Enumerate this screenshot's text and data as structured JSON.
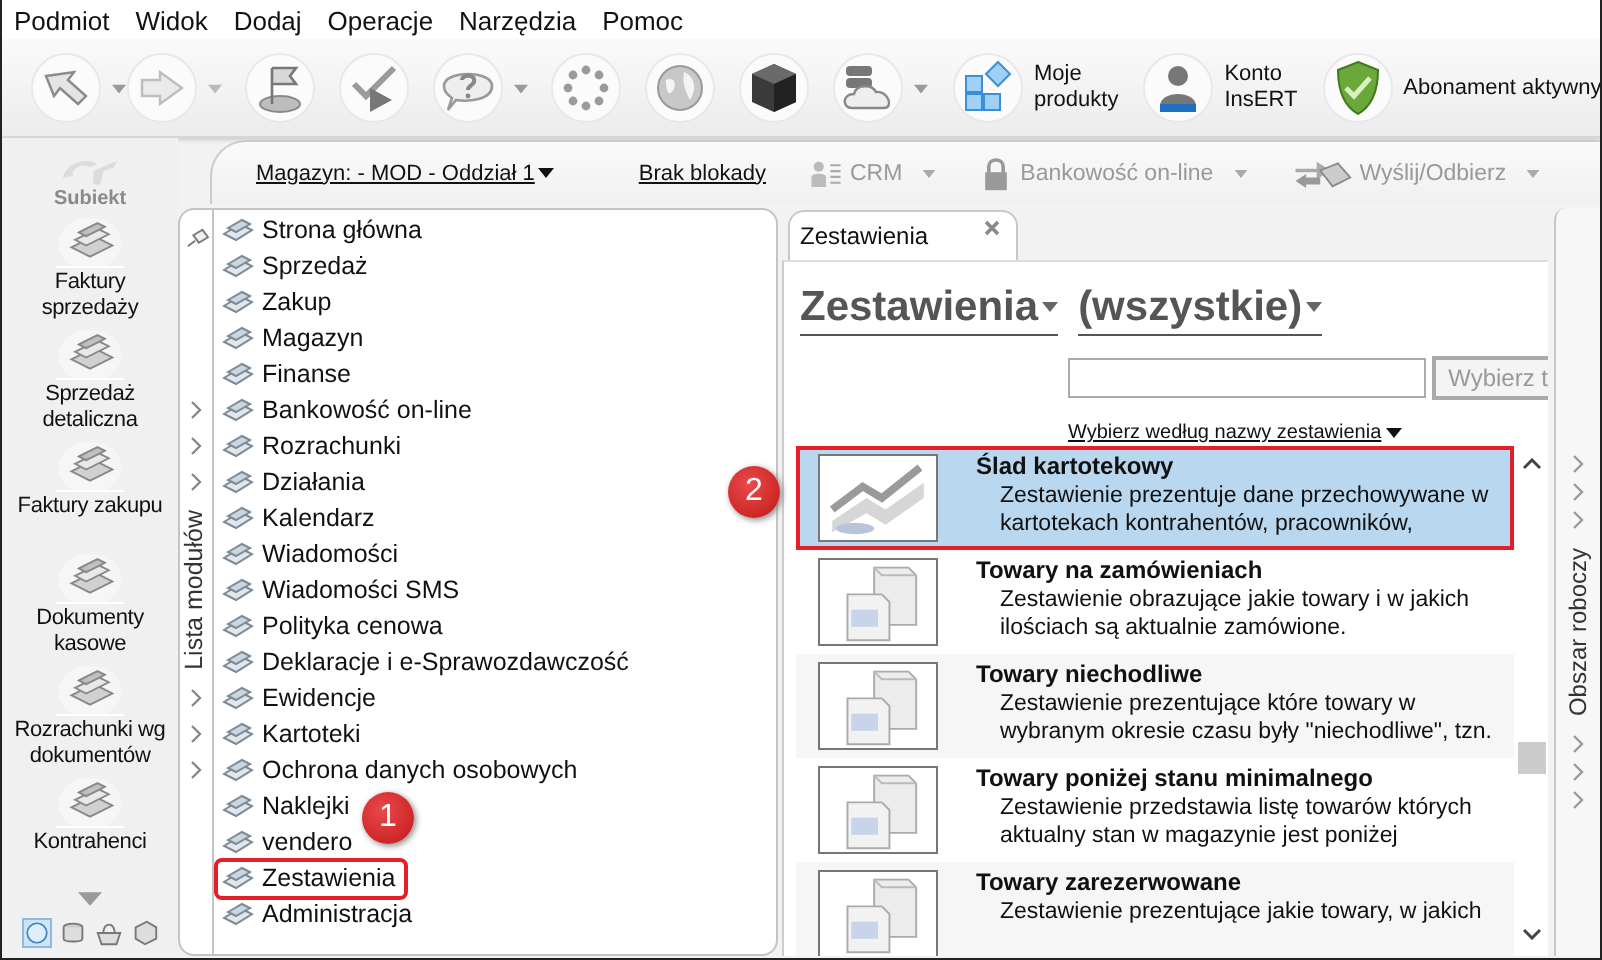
{
  "menu": [
    "Podmiot",
    "Widok",
    "Dodaj",
    "Operacje",
    "Narzędzia",
    "Pomoc"
  ],
  "toolbar": {
    "buttons": [
      {
        "kind": "products",
        "label": "Moje produkty"
      },
      {
        "kind": "account",
        "label": "Konto InsERT"
      },
      {
        "kind": "subscription",
        "label": "Abonament aktywny"
      }
    ]
  },
  "app_logo": {
    "label": "Subiekt"
  },
  "nav": {
    "items": [
      {
        "label": "Faktury sprzedaży"
      },
      {
        "label": "Sprzedaż detaliczna"
      },
      {
        "label": "Faktury zakupu"
      },
      {
        "label": "Dokumenty kasowe"
      },
      {
        "label": "Rozrachunki wg dokumentów"
      },
      {
        "label": "Kontrahenci"
      }
    ]
  },
  "topbar": {
    "warehouse": "Magazyn: - MOD - Oddział 1",
    "lock": "Brak blokady",
    "actions": [
      {
        "kind": "crm",
        "label": "CRM",
        "disabled": true
      },
      {
        "kind": "bank",
        "label": "Bankowość on-line",
        "disabled": true
      },
      {
        "kind": "send",
        "label": "Wyślij/Odbierz",
        "disabled": true
      }
    ]
  },
  "modules": {
    "title": "Lista modułów",
    "items": [
      {
        "label": "Strona główna",
        "expandable": false,
        "highlighted": false
      },
      {
        "label": "Sprzedaż",
        "expandable": false,
        "highlighted": false
      },
      {
        "label": "Zakup",
        "expandable": false,
        "highlighted": false
      },
      {
        "label": "Magazyn",
        "expandable": false,
        "highlighted": false
      },
      {
        "label": "Finanse",
        "expandable": false,
        "highlighted": false
      },
      {
        "label": "Bankowość on-line",
        "expandable": true,
        "highlighted": false
      },
      {
        "label": "Rozrachunki",
        "expandable": true,
        "highlighted": false
      },
      {
        "label": "Działania",
        "expandable": true,
        "highlighted": false
      },
      {
        "label": "Kalendarz",
        "expandable": false,
        "highlighted": false
      },
      {
        "label": "Wiadomości",
        "expandable": false,
        "highlighted": false
      },
      {
        "label": "Wiadomości SMS",
        "expandable": false,
        "highlighted": false
      },
      {
        "label": "Polityka cenowa",
        "expandable": false,
        "highlighted": false
      },
      {
        "label": "Deklaracje i e-Sprawozdawczość",
        "expandable": false,
        "highlighted": false
      },
      {
        "label": "Ewidencje",
        "expandable": true,
        "highlighted": false
      },
      {
        "label": "Kartoteki",
        "expandable": true,
        "highlighted": false
      },
      {
        "label": "Ochrona danych osobowych",
        "expandable": true,
        "highlighted": false
      },
      {
        "label": "Naklejki",
        "expandable": false,
        "highlighted": false
      },
      {
        "label": "vendero",
        "expandable": false,
        "highlighted": false
      },
      {
        "label": "Zestawienia",
        "expandable": false,
        "highlighted": true
      },
      {
        "label": "Administracja",
        "expandable": false,
        "highlighted": false
      }
    ]
  },
  "tabs": [
    {
      "label": "Zestawienia",
      "selected": true
    }
  ],
  "reports": {
    "category": "Zestawienia",
    "filter": "(wszystkie)",
    "search_button": "Wybierz t",
    "sort_link": "Wybierz według nazwy zestawienia",
    "items": [
      {
        "kind": "chart",
        "title": "Ślad kartotekowy",
        "description": "Zestawienie prezentuje dane przechowywane w\nkartotekach kontrahentów, pracowników,",
        "selected": true,
        "highlighted": true
      },
      {
        "kind": "boxes",
        "title": "Towary na zamówieniach",
        "description": "Zestawienie obrazujące jakie towary i w jakich\nilościach są aktualnie zamówione.",
        "selected": false,
        "highlighted": false
      },
      {
        "kind": "boxes",
        "title": "Towary niechodliwe",
        "description": "Zestawienie prezentujące które towary w\nwybranym okresie czasu były \"niechodliwe\", tzn.",
        "selected": false,
        "highlighted": false
      },
      {
        "kind": "boxes",
        "title": "Towary poniżej stanu minimalnego",
        "description": "Zestawienie przedstawia listę towarów których\naktualny stan w magazynie jest poniżej",
        "selected": false,
        "highlighted": false
      },
      {
        "kind": "boxes",
        "title": "Towary zarezerwowane",
        "description": "Zestawienie prezentujące jakie towary, w jakich",
        "selected": false,
        "highlighted": false
      }
    ]
  },
  "side_panel": {
    "title": "Obszar roboczy"
  },
  "annotations": [
    {
      "label": "1"
    },
    {
      "label": "2"
    }
  ]
}
